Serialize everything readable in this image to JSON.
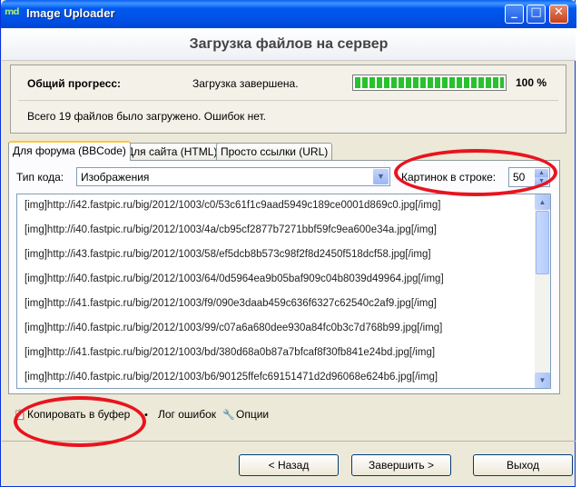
{
  "window": {
    "title": "Image Uploader",
    "icon_text": "md",
    "controls": {
      "minimize": "_",
      "maximize": "□",
      "close": "✕"
    }
  },
  "header": {
    "title": "Загрузка файлов на сервер"
  },
  "progress": {
    "label": "Общий прогресс:",
    "status": "Загрузка завершена.",
    "percent_text": "100 %",
    "fraction": 1.0,
    "bar_color": "#29c12e",
    "summary": "Всего 19 файлов было загружено. Ошибок нет."
  },
  "tabs": [
    {
      "label": "Для форума (BBCode)",
      "active": true
    },
    {
      "label": "Для сайта (HTML)",
      "active": false
    },
    {
      "label": "Просто ссылки (URL)",
      "active": false
    }
  ],
  "options": {
    "code_type_label": "Тип кода:",
    "code_type_value": "Изображения",
    "per_row_label": "Картинок в строке:",
    "per_row_value": "50"
  },
  "links": [
    "[img]http://i42.fastpic.ru/big/2012/1003/c0/53c61f1c9aad5949c189ce0001d869c0.jpg[/img]",
    "[img]http://i40.fastpic.ru/big/2012/1003/4a/cb95cf2877b7271bbf59fc9ea600e34a.jpg[/img]",
    "[img]http://i43.fastpic.ru/big/2012/1003/58/ef5dcb8b573c98f2f8d2450f518dcf58.jpg[/img]",
    "[img]http://i40.fastpic.ru/big/2012/1003/64/0d5964ea9b05baf909c04b8039d49964.jpg[/img]",
    "[img]http://i41.fastpic.ru/big/2012/1003/f9/090e3daab459c636f6327c62540c2af9.jpg[/img]",
    "[img]http://i40.fastpic.ru/big/2012/1003/99/c07a6a680dee930a84fc0b3c7d768b99.jpg[/img]",
    "[img]http://i41.fastpic.ru/big/2012/1003/bd/380d68a0b87a7bfcaf8f30fb841e24bd.jpg[/img]",
    "[img]http://i40.fastpic.ru/big/2012/1003/b6/90125ffefc69151471d2d96068e624b6.jpg[/img]"
  ],
  "bottom_links": {
    "copy": "Копировать в буфер",
    "errors": "Лог ошибок",
    "options": "Опции"
  },
  "buttons": {
    "back": "< Назад",
    "finish": "Завершить >",
    "exit": "Выход"
  },
  "annotation_color": "#e8141e"
}
